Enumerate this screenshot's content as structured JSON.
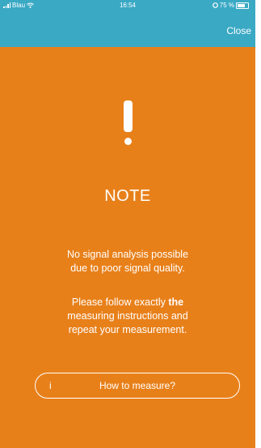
{
  "status_bar": {
    "carrier": "Blau",
    "time": "16:54",
    "battery": "75 %"
  },
  "header": {
    "close_label": "Close"
  },
  "note": {
    "title": "NOTE",
    "message_1_line_1": "No signal analysis possible",
    "message_1_line_2": "due to poor signal quality.",
    "message_2_line_1_a": "Please follow exactly ",
    "message_2_line_1_b": "the",
    "message_2_line_2": "measuring instructions and",
    "message_2_line_3": "repeat your measurement."
  },
  "how_to": {
    "icon_glyph": "i",
    "label": "How to measure?"
  },
  "colors": {
    "background": "#e8801a",
    "header": "#3aa9c4",
    "text": "#ffffff"
  }
}
